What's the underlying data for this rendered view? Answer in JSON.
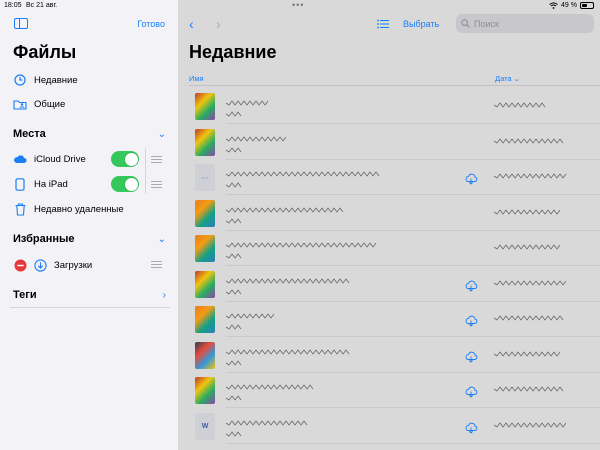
{
  "status": {
    "time": "18:05",
    "date": "Вс 21 авг.",
    "battery": "49 %",
    "battery_level": 0.49
  },
  "sidebar": {
    "done_label": "Готово",
    "title": "Файлы",
    "top_items": [
      {
        "label": "Недавние",
        "icon": "clock-icon"
      },
      {
        "label": "Общие",
        "icon": "shared-folder-icon"
      }
    ],
    "places_header": "Места",
    "places": [
      {
        "label": "iCloud Drive",
        "icon": "icloud-icon",
        "enabled": true
      },
      {
        "label": "На iPad",
        "icon": "ipad-icon",
        "enabled": true
      },
      {
        "label": "Недавно удаленные",
        "icon": "trash-icon"
      }
    ],
    "favorites_header": "Избранные",
    "favorites": [
      {
        "label": "Загрузки",
        "icon": "download-icon"
      }
    ],
    "tags_header": "Теги"
  },
  "main": {
    "title": "Недавние",
    "select_label": "Выбрать",
    "search_placeholder": "Поиск",
    "col_name": "Имя",
    "col_date": "Дата",
    "accent": "#1c7ef5"
  }
}
